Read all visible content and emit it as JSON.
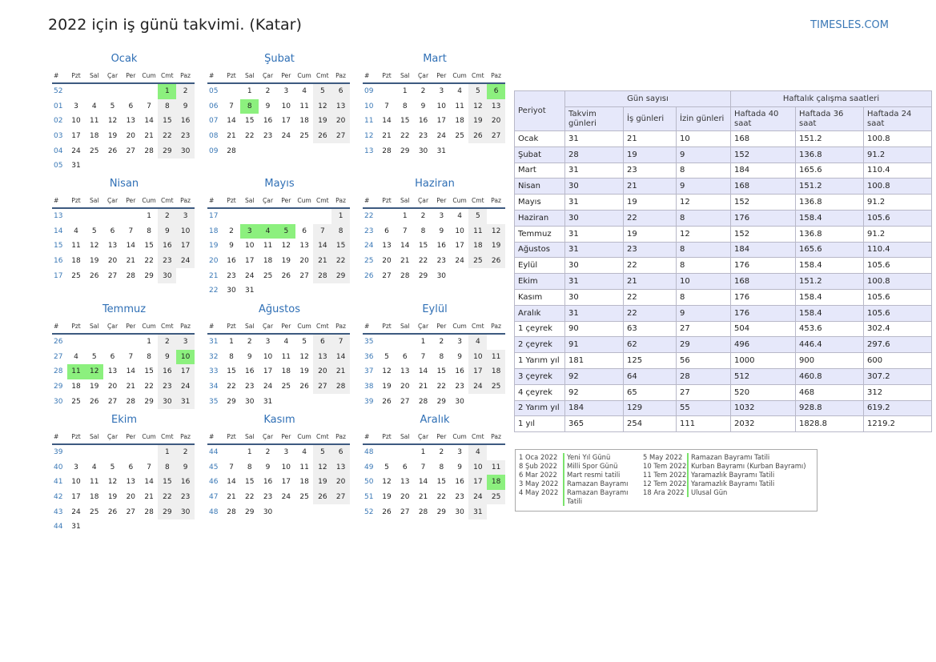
{
  "page": {
    "title": "2022 için iş günü takvimi. (Katar)",
    "site": "TIMESLES.COM"
  },
  "weekday_header": [
    "#",
    "Pzt",
    "Sal",
    "Çar",
    "Per",
    "Cum",
    "Cmt",
    "Paz"
  ],
  "months": [
    {
      "name": "Ocak",
      "weeks": [
        [
          "52",
          "",
          "",
          "",
          "",
          "",
          "1",
          "2"
        ],
        [
          "01",
          "3",
          "4",
          "5",
          "6",
          "7",
          "8",
          "9"
        ],
        [
          "02",
          "10",
          "11",
          "12",
          "13",
          "14",
          "15",
          "16"
        ],
        [
          "03",
          "17",
          "18",
          "19",
          "20",
          "21",
          "22",
          "23"
        ],
        [
          "04",
          "24",
          "25",
          "26",
          "27",
          "28",
          "29",
          "30"
        ],
        [
          "05",
          "31",
          "",
          "",
          "",
          "",
          "",
          ""
        ]
      ],
      "holidays": [
        "1"
      ]
    },
    {
      "name": "Şubat",
      "weeks": [
        [
          "05",
          "",
          "1",
          "2",
          "3",
          "4",
          "5",
          "6"
        ],
        [
          "06",
          "7",
          "8",
          "9",
          "10",
          "11",
          "12",
          "13"
        ],
        [
          "07",
          "14",
          "15",
          "16",
          "17",
          "18",
          "19",
          "20"
        ],
        [
          "08",
          "21",
          "22",
          "23",
          "24",
          "25",
          "26",
          "27"
        ],
        [
          "09",
          "28",
          "",
          "",
          "",
          "",
          "",
          ""
        ]
      ],
      "holidays": [
        "8"
      ]
    },
    {
      "name": "Mart",
      "weeks": [
        [
          "09",
          "",
          "1",
          "2",
          "3",
          "4",
          "5",
          "6"
        ],
        [
          "10",
          "7",
          "8",
          "9",
          "10",
          "11",
          "12",
          "13"
        ],
        [
          "11",
          "14",
          "15",
          "16",
          "17",
          "18",
          "19",
          "20"
        ],
        [
          "12",
          "21",
          "22",
          "23",
          "24",
          "25",
          "26",
          "27"
        ],
        [
          "13",
          "28",
          "29",
          "30",
          "31",
          "",
          "",
          ""
        ]
      ],
      "holidays": [
        "6"
      ]
    },
    {
      "name": "Nisan",
      "weeks": [
        [
          "13",
          "",
          "",
          "",
          "",
          "1",
          "2",
          "3"
        ],
        [
          "14",
          "4",
          "5",
          "6",
          "7",
          "8",
          "9",
          "10"
        ],
        [
          "15",
          "11",
          "12",
          "13",
          "14",
          "15",
          "16",
          "17"
        ],
        [
          "16",
          "18",
          "19",
          "20",
          "21",
          "22",
          "23",
          "24"
        ],
        [
          "17",
          "25",
          "26",
          "27",
          "28",
          "29",
          "30",
          ""
        ]
      ],
      "holidays": []
    },
    {
      "name": "Mayıs",
      "weeks": [
        [
          "17",
          "",
          "",
          "",
          "",
          "",
          "",
          "1"
        ],
        [
          "18",
          "2",
          "3",
          "4",
          "5",
          "6",
          "7",
          "8"
        ],
        [
          "19",
          "9",
          "10",
          "11",
          "12",
          "13",
          "14",
          "15"
        ],
        [
          "20",
          "16",
          "17",
          "18",
          "19",
          "20",
          "21",
          "22"
        ],
        [
          "21",
          "23",
          "24",
          "25",
          "26",
          "27",
          "28",
          "29"
        ],
        [
          "22",
          "30",
          "31",
          "",
          "",
          "",
          "",
          ""
        ]
      ],
      "holidays": [
        "3",
        "4",
        "5"
      ]
    },
    {
      "name": "Haziran",
      "weeks": [
        [
          "22",
          "",
          "1",
          "2",
          "3",
          "4",
          "5",
          ""
        ],
        [
          "23",
          "6",
          "7",
          "8",
          "9",
          "10",
          "11",
          "12"
        ],
        [
          "24",
          "13",
          "14",
          "15",
          "16",
          "17",
          "18",
          "19"
        ],
        [
          "25",
          "20",
          "21",
          "22",
          "23",
          "24",
          "25",
          "26"
        ],
        [
          "26",
          "27",
          "28",
          "29",
          "30",
          "",
          "",
          ""
        ]
      ],
      "holidays": []
    },
    {
      "name": "Temmuz",
      "weeks": [
        [
          "26",
          "",
          "",
          "",
          "",
          "1",
          "2",
          "3"
        ],
        [
          "27",
          "4",
          "5",
          "6",
          "7",
          "8",
          "9",
          "10"
        ],
        [
          "28",
          "11",
          "12",
          "13",
          "14",
          "15",
          "16",
          "17"
        ],
        [
          "29",
          "18",
          "19",
          "20",
          "21",
          "22",
          "23",
          "24"
        ],
        [
          "30",
          "25",
          "26",
          "27",
          "28",
          "29",
          "30",
          "31"
        ]
      ],
      "holidays": [
        "10",
        "11",
        "12"
      ]
    },
    {
      "name": "Ağustos",
      "weeks": [
        [
          "31",
          "1",
          "2",
          "3",
          "4",
          "5",
          "6",
          "7"
        ],
        [
          "32",
          "8",
          "9",
          "10",
          "11",
          "12",
          "13",
          "14"
        ],
        [
          "33",
          "15",
          "16",
          "17",
          "18",
          "19",
          "20",
          "21"
        ],
        [
          "34",
          "22",
          "23",
          "24",
          "25",
          "26",
          "27",
          "28"
        ],
        [
          "35",
          "29",
          "30",
          "31",
          "",
          "",
          "",
          ""
        ]
      ],
      "holidays": []
    },
    {
      "name": "Eylül",
      "weeks": [
        [
          "35",
          "",
          "",
          "1",
          "2",
          "3",
          "4",
          ""
        ],
        [
          "36",
          "5",
          "6",
          "7",
          "8",
          "9",
          "10",
          "11"
        ],
        [
          "37",
          "12",
          "13",
          "14",
          "15",
          "16",
          "17",
          "18"
        ],
        [
          "38",
          "19",
          "20",
          "21",
          "22",
          "23",
          "24",
          "25"
        ],
        [
          "39",
          "26",
          "27",
          "28",
          "29",
          "30",
          "",
          ""
        ]
      ],
      "holidays": []
    },
    {
      "name": "Ekim",
      "weeks": [
        [
          "39",
          "",
          "",
          "",
          "",
          "",
          "1",
          "2"
        ],
        [
          "40",
          "3",
          "4",
          "5",
          "6",
          "7",
          "8",
          "9"
        ],
        [
          "41",
          "10",
          "11",
          "12",
          "13",
          "14",
          "15",
          "16"
        ],
        [
          "42",
          "17",
          "18",
          "19",
          "20",
          "21",
          "22",
          "23"
        ],
        [
          "43",
          "24",
          "25",
          "26",
          "27",
          "28",
          "29",
          "30"
        ],
        [
          "44",
          "31",
          "",
          "",
          "",
          "",
          "",
          ""
        ]
      ],
      "holidays": []
    },
    {
      "name": "Kasım",
      "weeks": [
        [
          "44",
          "",
          "1",
          "2",
          "3",
          "4",
          "5",
          "6"
        ],
        [
          "45",
          "7",
          "8",
          "9",
          "10",
          "11",
          "12",
          "13"
        ],
        [
          "46",
          "14",
          "15",
          "16",
          "17",
          "18",
          "19",
          "20"
        ],
        [
          "47",
          "21",
          "22",
          "23",
          "24",
          "25",
          "26",
          "27"
        ],
        [
          "48",
          "28",
          "29",
          "30",
          "",
          "",
          "",
          ""
        ]
      ],
      "holidays": []
    },
    {
      "name": "Aralık",
      "weeks": [
        [
          "48",
          "",
          "",
          "1",
          "2",
          "3",
          "4",
          ""
        ],
        [
          "49",
          "5",
          "6",
          "7",
          "8",
          "9",
          "10",
          "11"
        ],
        [
          "50",
          "12",
          "13",
          "14",
          "15",
          "16",
          "17",
          "18"
        ],
        [
          "51",
          "19",
          "20",
          "21",
          "22",
          "23",
          "24",
          "25"
        ],
        [
          "52",
          "26",
          "27",
          "28",
          "29",
          "30",
          "31",
          ""
        ]
      ],
      "holidays": [
        "18"
      ]
    }
  ],
  "summary": {
    "group_days": "Gün sayısı",
    "group_hours": "Haftalık çalışma saatleri",
    "col_period": "Periyot",
    "cols": [
      "Takvim günleri",
      "İş günleri",
      "İzin günleri",
      "Haftada 40 saat",
      "Haftada 36 saat",
      "Haftada 24 saat"
    ],
    "rows": [
      [
        "Ocak",
        "31",
        "21",
        "10",
        "168",
        "151.2",
        "100.8"
      ],
      [
        "Şubat",
        "28",
        "19",
        "9",
        "152",
        "136.8",
        "91.2"
      ],
      [
        "Mart",
        "31",
        "23",
        "8",
        "184",
        "165.6",
        "110.4"
      ],
      [
        "Nisan",
        "30",
        "21",
        "9",
        "168",
        "151.2",
        "100.8"
      ],
      [
        "Mayıs",
        "31",
        "19",
        "12",
        "152",
        "136.8",
        "91.2"
      ],
      [
        "Haziran",
        "30",
        "22",
        "8",
        "176",
        "158.4",
        "105.6"
      ],
      [
        "Temmuz",
        "31",
        "19",
        "12",
        "152",
        "136.8",
        "91.2"
      ],
      [
        "Ağustos",
        "31",
        "23",
        "8",
        "184",
        "165.6",
        "110.4"
      ],
      [
        "Eylül",
        "30",
        "22",
        "8",
        "176",
        "158.4",
        "105.6"
      ],
      [
        "Ekim",
        "31",
        "21",
        "10",
        "168",
        "151.2",
        "100.8"
      ],
      [
        "Kasım",
        "30",
        "22",
        "8",
        "176",
        "158.4",
        "105.6"
      ],
      [
        "Aralık",
        "31",
        "22",
        "9",
        "176",
        "158.4",
        "105.6"
      ],
      [
        "1 çeyrek",
        "90",
        "63",
        "27",
        "504",
        "453.6",
        "302.4"
      ],
      [
        "2 çeyrek",
        "91",
        "62",
        "29",
        "496",
        "446.4",
        "297.6"
      ],
      [
        "1 Yarım yıl",
        "181",
        "125",
        "56",
        "1000",
        "900",
        "600"
      ],
      [
        "3 çeyrek",
        "92",
        "64",
        "28",
        "512",
        "460.8",
        "307.2"
      ],
      [
        "4 çeyrek",
        "92",
        "65",
        "27",
        "520",
        "468",
        "312"
      ],
      [
        "2 Yarım yıl",
        "184",
        "129",
        "55",
        "1032",
        "928.8",
        "619.2"
      ],
      [
        "1 yıl",
        "365",
        "254",
        "111",
        "2032",
        "1828.8",
        "1219.2"
      ]
    ]
  },
  "holidays_list": [
    [
      {
        "date": "1 Oca 2022",
        "name": "Yeni Yıl Günü"
      },
      {
        "date": "8 Şub 2022",
        "name": "Milli Spor Günü"
      },
      {
        "date": "6 Mar 2022",
        "name": "Mart resmi tatili"
      },
      {
        "date": "3 May 2022",
        "name": "Ramazan Bayramı"
      },
      {
        "date": "4 May 2022",
        "name": "Ramazan Bayramı Tatili"
      }
    ],
    [
      {
        "date": "5 May 2022",
        "name": "Ramazan Bayramı Tatili"
      },
      {
        "date": "10 Tem 2022",
        "name": "Kurban Bayramı (Kurban Bayramı)"
      },
      {
        "date": "11 Tem 2022",
        "name": "Yaramazlık Bayramı Tatili"
      },
      {
        "date": "12 Tem 2022",
        "name": "Yaramazlık Bayramı Tatili"
      },
      {
        "date": "18 Ara 2022",
        "name": "Ulusal Gün"
      }
    ]
  ]
}
